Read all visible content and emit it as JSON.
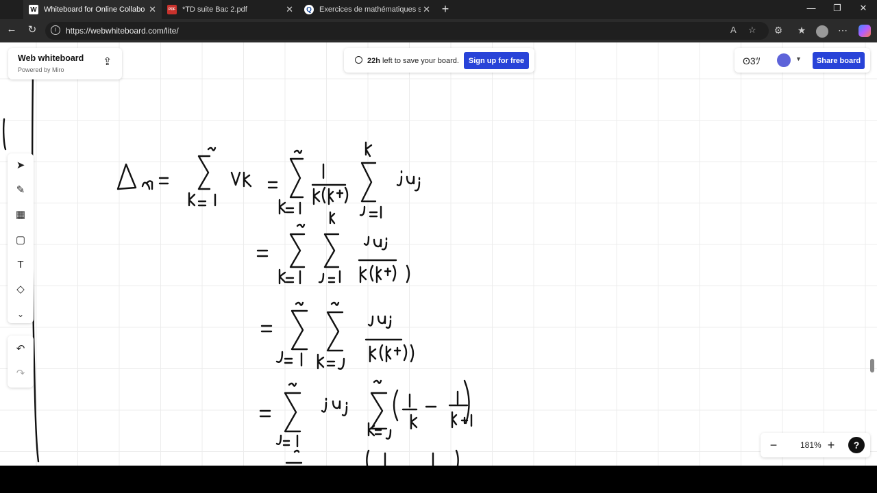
{
  "browser": {
    "tabs": [
      {
        "title": "Whiteboard for Online Collaboration",
        "favicon": "W"
      },
      {
        "title": "*TD suite Bac 2.pdf",
        "favicon": "PDF"
      },
      {
        "title": "Exercices de mathématiques supérieures",
        "favicon": "Q"
      }
    ],
    "url": "https://webwhiteboard.com/lite/"
  },
  "board": {
    "brand_name": "Web whiteboard",
    "powered_by": "Powered by Miro",
    "save_hours": "22h",
    "save_message": "left to save your board.",
    "signup_label": "Sign up for free",
    "reactions_icon": "ʘ3ﾂ",
    "share_label": "Share board",
    "zoom_level": "181%",
    "help_label": "?"
  },
  "tools": [
    "select-tool",
    "pen-tool",
    "frame-tool",
    "sticky-note-tool",
    "text-tool",
    "shapes-tool",
    "more-tools"
  ],
  "colors": {
    "accent": "#2843d8",
    "ink": "#111111",
    "browser_dark": "#2b2b2b"
  }
}
